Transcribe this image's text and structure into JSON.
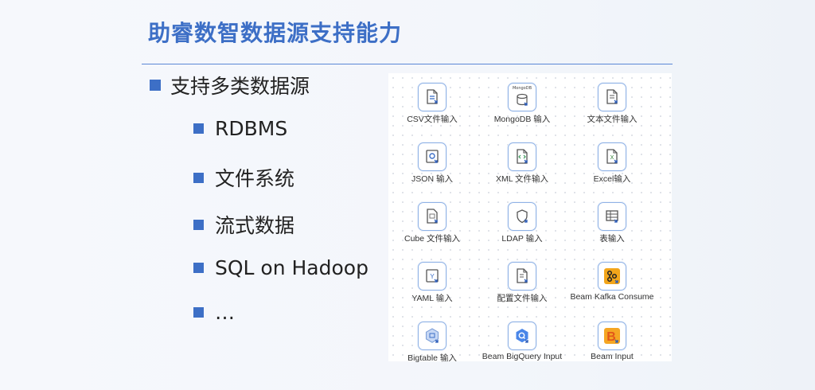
{
  "slide": {
    "title": "助睿数智数据源支持能力",
    "main_bullet": "支持多类数据源",
    "sub_bullets": [
      "RDBMS",
      "文件系统",
      "流式数据",
      "SQL on Hadoop",
      "…"
    ]
  },
  "steps_panel": {
    "items": [
      {
        "label": "CSV文件输入",
        "icon": "csv-file-icon"
      },
      {
        "label": "MongoDB 输入",
        "icon": "mongodb-icon",
        "icon_text": "MongoDB"
      },
      {
        "label": "文本文件输入",
        "icon": "text-file-icon"
      },
      {
        "label": "JSON 输入",
        "icon": "json-icon"
      },
      {
        "label": "XML 文件输入",
        "icon": "xml-file-icon"
      },
      {
        "label": "Excel输入",
        "icon": "excel-icon",
        "icon_text": "X"
      },
      {
        "label": "Cube 文件输入",
        "icon": "cube-file-icon"
      },
      {
        "label": "LDAP 输入",
        "icon": "ldap-shield-icon"
      },
      {
        "label": "表输入",
        "icon": "table-icon"
      },
      {
        "label": "YAML 输入",
        "icon": "yaml-icon",
        "icon_text": "Y"
      },
      {
        "label": "配置文件输入",
        "icon": "config-file-icon"
      },
      {
        "label": "Beam Kafka Consume",
        "icon": "kafka-icon"
      },
      {
        "label": "Bigtable 输入",
        "icon": "bigtable-icon"
      },
      {
        "label": "Beam BigQuery Input",
        "icon": "bigquery-icon"
      },
      {
        "label": "Beam Input",
        "icon": "beam-icon",
        "icon_text": "B"
      }
    ]
  },
  "colors": {
    "accent": "#3d6fc6",
    "icon_border": "#8fb2e6",
    "kafka": "#f2a51a",
    "beam": "#f5a623"
  }
}
